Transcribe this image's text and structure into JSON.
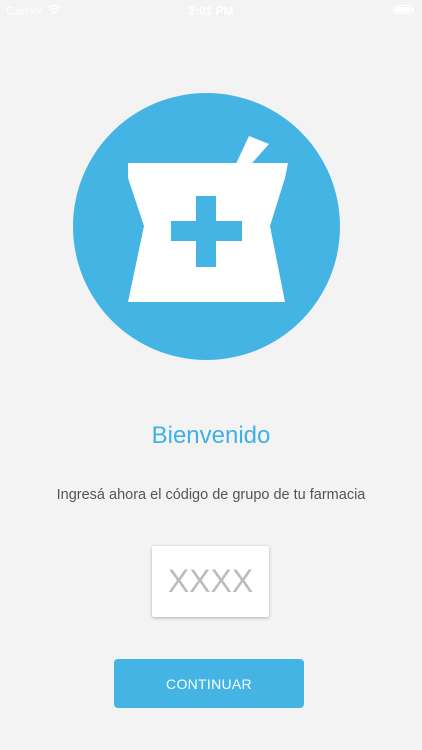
{
  "status_bar": {
    "carrier": "Carrier",
    "time": "3:01 PM",
    "wifi_icon": "wifi-icon",
    "battery_icon": "battery-icon"
  },
  "logo": {
    "icon": "pharmacy-mortar-cross-icon",
    "circle_color": "#44b4e5",
    "glyph_color": "#ffffff"
  },
  "welcome": {
    "title": "Bienvenido",
    "subtitle": "Ingresá ahora el código de grupo de tu farmacia"
  },
  "group_code": {
    "value": "",
    "placeholder": "XXXX"
  },
  "continue_label": "CONTINUAR",
  "colors": {
    "accent": "#44b4e5",
    "background": "#f3f3f3"
  }
}
